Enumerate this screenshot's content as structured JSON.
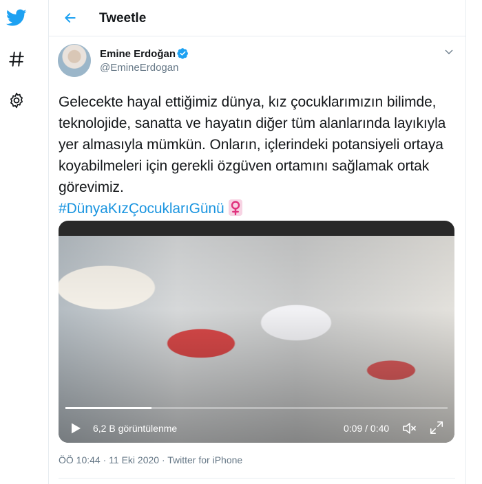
{
  "rail": {
    "twitter_icon": "twitter-bird-icon",
    "explore_icon": "hashtag-icon",
    "settings_icon": "gear-icon"
  },
  "header": {
    "title": "Tweetle"
  },
  "tweet": {
    "author": {
      "name": "Emine Erdoğan",
      "handle": "@EmineErdogan"
    },
    "text": "Gelecekte hayal ettiğimiz dünya, kız çocuklarımızın bilimde, teknolojide, sanatta ve hayatın diğer tüm alanlarında layıkıyla yer almasıyla mümkün. Onların, içlerindeki potansiyeli ortaya koyabilmeleri için gerekli özgüven ortamını sağlamak ortak görevimiz.",
    "hashtag": "#DünyaKızÇocuklarıGünü",
    "meta": "ÖÖ 10:44 · 11 Eki 2020 · Twitter for iPhone"
  },
  "video": {
    "views": "6,2 B görüntülenme",
    "time": "0:09 / 0:40",
    "progress": 0.225
  },
  "colors": {
    "accent": "#1da1f2",
    "hashtag": "#1b95e0",
    "muted": "#657786",
    "female_sign": "#e0327d"
  }
}
